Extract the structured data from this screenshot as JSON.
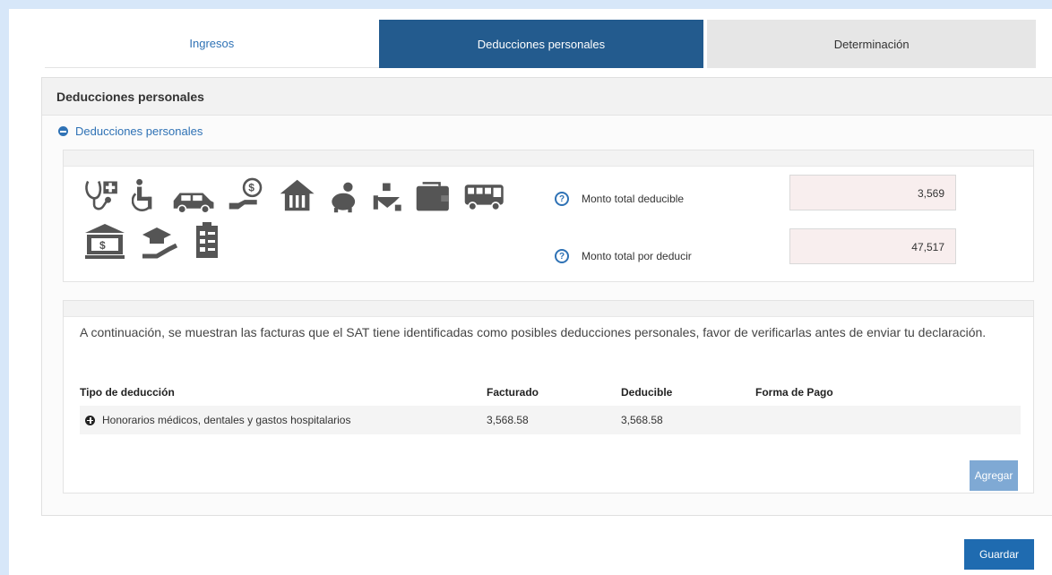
{
  "tabs": [
    {
      "label": "Ingresos",
      "active": false
    },
    {
      "label": "Deducciones personales",
      "active": true
    },
    {
      "label": "Determinación",
      "active": false
    }
  ],
  "panel": {
    "title": "Deducciones personales",
    "section_label": "Deducciones personales"
  },
  "icons": [
    "medical-fees-icon",
    "disability-icon",
    "car-icon",
    "money-hand-icon",
    "house-icon",
    "piggy-bank-icon",
    "donation-icon",
    "wallet-icon",
    "bus-icon",
    "bank-icon",
    "education-icon",
    "insurance-clipboard-icon"
  ],
  "totals": {
    "deductible_label": "Monto total deducible",
    "deductible_value": "3,569",
    "pending_label": "Monto total por deducir",
    "pending_value": "47,517"
  },
  "invoices": {
    "note": "A continuación, se muestran las facturas que el SAT tiene identificadas como posibles deducciones personales, favor de verificarlas antes de enviar tu declaración.",
    "headers": [
      "Tipo de deducción",
      "Facturado",
      "Deducible",
      "Forma de Pago"
    ],
    "rows": [
      {
        "tipo": "Honorarios médicos, dentales y gastos hospitalarios",
        "facturado": "3,568.58",
        "deducible": "3,568.58",
        "forma_pago": ""
      }
    ]
  },
  "buttons": {
    "add": "Agregar",
    "save": "Guardar"
  },
  "colors": {
    "background": "#d7e7f9",
    "active_tab": "#235b8e",
    "link": "#2f72b5",
    "primary_button": "#1f6bb0",
    "disabled_button": "#7fa9d4"
  }
}
